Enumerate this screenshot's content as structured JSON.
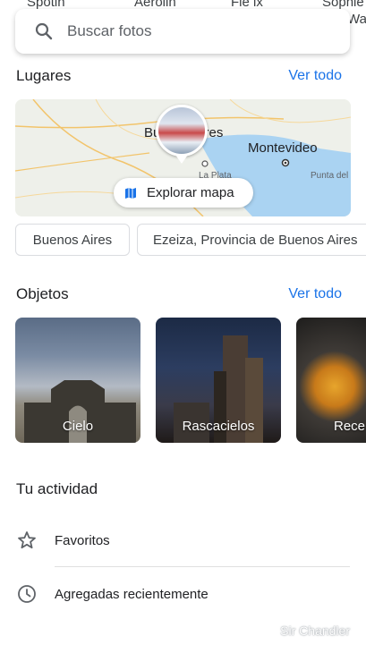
{
  "top_chips": [
    "Spotin",
    "Aerolin",
    "Fle ix",
    "Sophie",
    "Wal"
  ],
  "search": {
    "placeholder": "Buscar fotos"
  },
  "places": {
    "title": "Lugares",
    "see_all": "Ver todo",
    "map": {
      "labels": [
        "Buenos Aires",
        "Montevideo",
        "La Plata",
        "Punta del"
      ],
      "button_label": "Explorar mapa"
    },
    "chips": [
      "Buenos Aires",
      "Ezeiza, Provincia de Buenos Aires"
    ]
  },
  "objects": {
    "title": "Objetos",
    "see_all": "Ver todo",
    "items": [
      {
        "label": "Cielo"
      },
      {
        "label": "Rascacielos"
      },
      {
        "label": "Rece"
      }
    ]
  },
  "activity": {
    "title": "Tu actividad",
    "items": [
      {
        "label": "Favoritos",
        "icon": "star-outline-icon"
      },
      {
        "label": "Agregadas recientemente",
        "icon": "clock-icon"
      }
    ]
  },
  "watermark": "Sir Chandler",
  "colors": {
    "accent": "#1a73e8",
    "water": "#aad3f2",
    "land": "#eef0ea"
  }
}
